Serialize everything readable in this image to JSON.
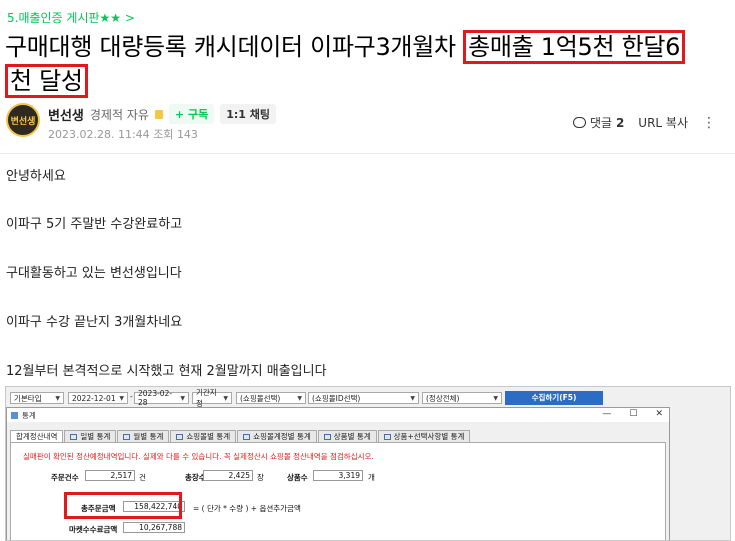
{
  "board": {
    "label": "5.매출인증 게시판",
    "stars": "★★",
    "chevron": ">"
  },
  "post": {
    "title_plain": "구매대행 대량등록 캐시데이터 이파구3개월차",
    "title_highlight_1": "총매출 1억5천 한달6",
    "title_highlight_2": "천 달성"
  },
  "author": {
    "avatar_text": "변선생",
    "name": "변선생",
    "level": "경제적 자유",
    "subscribe_label": "+ 구독",
    "chat_label": "1:1 채팅",
    "date": "2023.02.28. 11:44",
    "views_label": "조회",
    "views": "143"
  },
  "actions": {
    "comments_label": "댓글",
    "comments_count": "2",
    "url_copy": "URL 복사",
    "more": "⋮"
  },
  "body": [
    "안녕하세요",
    "이파구 5기 주말반 수강완료하고",
    "구대활동하고 있는 변선생입니다",
    "이파구 수강 끝난지 3개월차네요",
    "12월부터 본격적으로 시작했고 현재 2월말까지 매출입니다"
  ],
  "screenshot": {
    "toolbar": {
      "period_type": "기본타입",
      "date_from": "2022-12-01",
      "date_sep": "-",
      "date_to": "2023-02-28",
      "period_select": "기간지정",
      "mall_select": "(쇼핑몰선택)",
      "mall_id_select": "(쇼핑몰ID선택)",
      "status_select": "(정상전체)",
      "collect_button": "수집하기(F5)"
    },
    "window": {
      "title": "통계",
      "minimize": "—",
      "maximize": "☐",
      "close": "✕",
      "tabs": [
        "합계정산내역",
        "일별 통계",
        "월별 통계",
        "쇼핑몰별 통계",
        "쇼핑몰계정별 통계",
        "상품별 통계",
        "상품+선택사항별 통계"
      ],
      "warning": "실매판이 확인된 정산예정내역입니다. 실제와 다를 수 있습니다. 꼭 실제정산시 쇼핑몰 정산내역을 점검하십시오.",
      "order_count_label": "주문건수",
      "order_count": "2,517",
      "order_count_unit": "건",
      "qty_label": "총장수",
      "qty": "2,425",
      "qty_unit": "장",
      "products_label": "상품수",
      "products": "3,319",
      "products_unit": "개",
      "total_order_label": "총주문금액",
      "total_order": "158,422,740",
      "formula": "= ( 단가  *  수량 ) + 옵션추가금액",
      "market_fee_label": "마켓수수료금액",
      "market_fee": "10,267,788"
    }
  }
}
